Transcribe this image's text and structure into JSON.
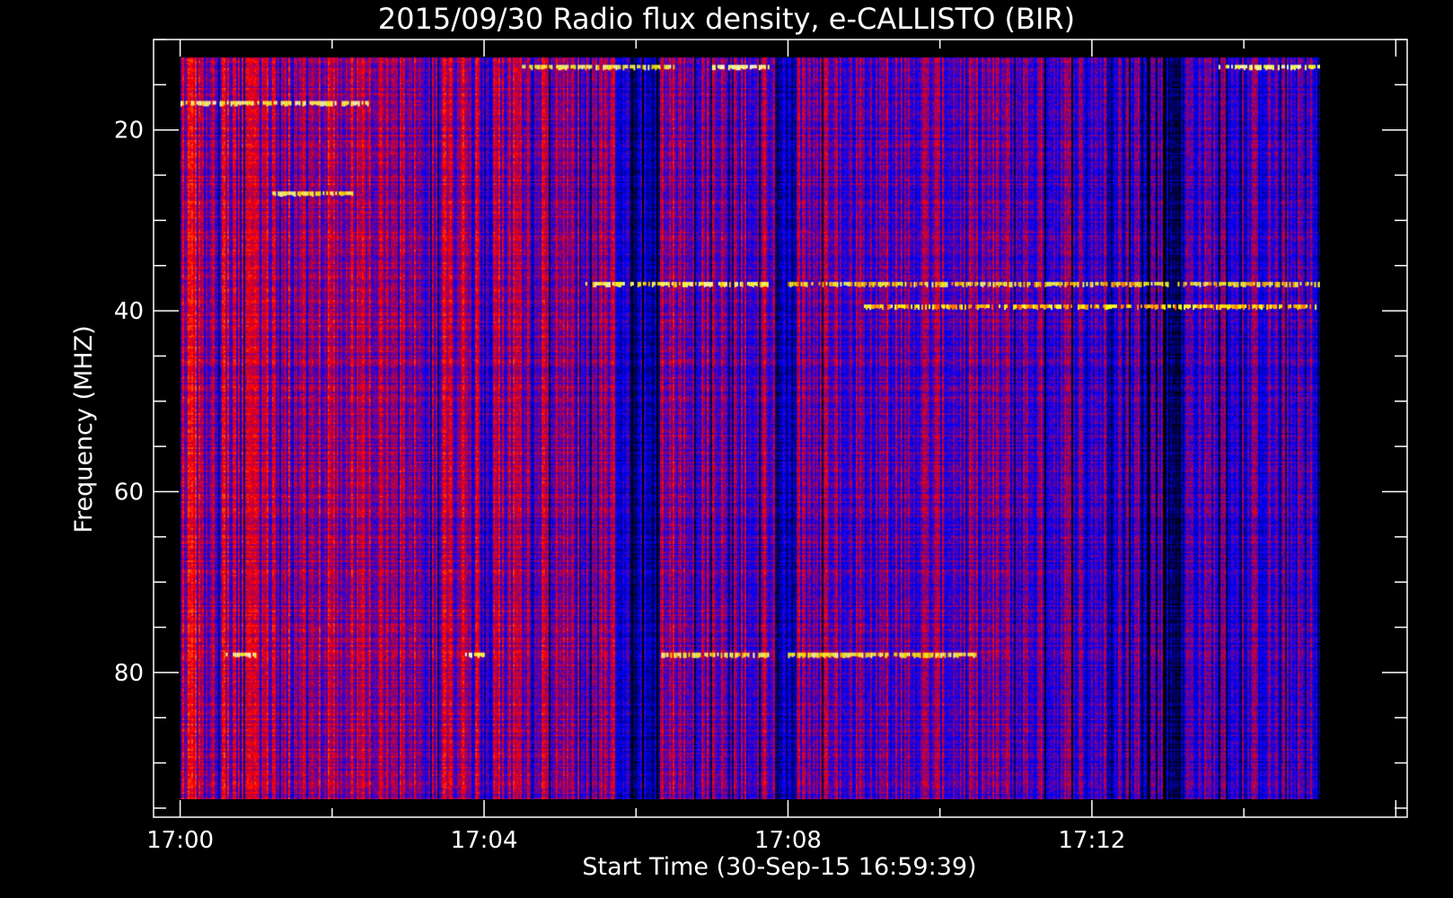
{
  "chart_data": {
    "type": "heatmap",
    "title": "2015/09/30  Radio flux density, e-CALLISTO (BIR)",
    "xlabel": "Start Time (30-Sep-15 16:59:39)",
    "ylabel": "Frequency (MHZ)",
    "x_range": [
      "16:59:39",
      "17:16:09"
    ],
    "data_x_range": [
      "17:00:00",
      "17:15:00"
    ],
    "y_range": [
      10,
      96
    ],
    "data_y_range": [
      12,
      94
    ],
    "y_inverted": true,
    "x_ticks": [
      "17:00",
      "17:04",
      "17:08",
      "17:12"
    ],
    "y_ticks": [
      20,
      40,
      60,
      80
    ],
    "x_minor_ticks_per_major": 2,
    "y_minor_ticks_per_major": 4,
    "colormap": [
      "#000000",
      "#0000ff",
      "#ff0000",
      "#ffff00",
      "#ffffff"
    ],
    "background": "#000000",
    "axis_color": "#ffffff",
    "features": [
      {
        "kind": "band",
        "frequency": 78,
        "time_start": "17:00:36",
        "time_end": "17:01:00",
        "level": 0.85
      },
      {
        "kind": "band",
        "frequency": 78,
        "time_start": "17:03:45",
        "time_end": "17:04:00",
        "level": 0.85
      },
      {
        "kind": "band",
        "frequency": 78,
        "time_start": "17:06:20",
        "time_end": "17:07:45",
        "level": 0.8
      },
      {
        "kind": "band",
        "frequency": 78,
        "time_start": "17:08:00",
        "time_end": "17:10:30",
        "level": 0.8
      },
      {
        "kind": "band",
        "frequency": 37,
        "time_start": "17:05:20",
        "time_end": "17:07:45",
        "level": 0.8
      },
      {
        "kind": "band",
        "frequency": 37,
        "time_start": "17:08:00",
        "time_end": "17:15:00",
        "level": 0.75
      },
      {
        "kind": "band",
        "frequency": 39.5,
        "time_start": "17:09:00",
        "time_end": "17:15:00",
        "level": 0.7
      },
      {
        "kind": "band",
        "frequency": 13,
        "time_start": "17:07:00",
        "time_end": "17:07:45",
        "level": 0.9
      },
      {
        "kind": "band",
        "frequency": 13,
        "time_start": "17:04:30",
        "time_end": "17:06:30",
        "level": 0.8
      },
      {
        "kind": "band",
        "frequency": 13,
        "time_start": "17:13:40",
        "time_end": "17:15:00",
        "level": 0.85
      },
      {
        "kind": "band",
        "frequency": 17,
        "time_start": "17:00:00",
        "time_end": "17:02:30",
        "level": 0.85
      },
      {
        "kind": "band",
        "frequency": 27,
        "time_start": "17:01:10",
        "time_end": "17:02:20",
        "level": 0.8
      }
    ]
  }
}
